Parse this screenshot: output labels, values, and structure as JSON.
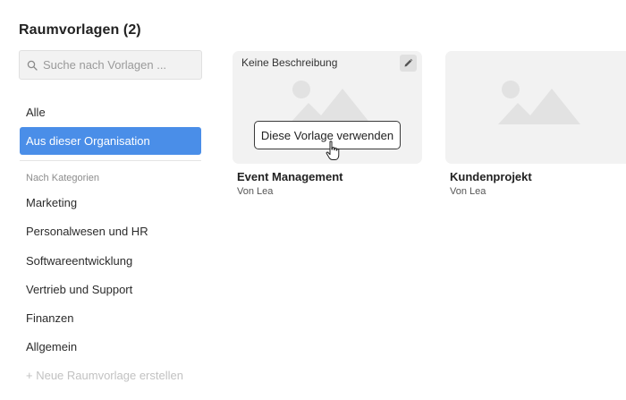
{
  "header": {
    "title": "Raumvorlagen (2)"
  },
  "search": {
    "placeholder": "Suche nach Vorlagen ..."
  },
  "sidebar": {
    "items": [
      {
        "label": "Alle",
        "active": false
      },
      {
        "label": "Aus dieser Organisation",
        "active": true
      }
    ],
    "section_label": "Nach Kategorien",
    "categories": [
      {
        "label": "Marketing"
      },
      {
        "label": "Personalwesen und HR"
      },
      {
        "label": "Softwareentwicklung"
      },
      {
        "label": "Vertrieb und Support"
      },
      {
        "label": "Finanzen"
      },
      {
        "label": "Allgemein"
      }
    ],
    "create_label": "+ Neue Raumvorlage erstellen"
  },
  "templates": [
    {
      "description": "Keine Beschreibung",
      "use_label": "Diese Vorlage verwenden",
      "name": "Event Management",
      "author": "Von Lea"
    },
    {
      "name": "Kundenprojekt",
      "author": "Von Lea"
    }
  ],
  "colors": {
    "accent": "#4a8ee8",
    "card_bg": "#f2f2f2",
    "placeholder_icon": "#e2e2e2"
  },
  "icons": {
    "search": "search-icon",
    "edit": "pencil-icon",
    "image": "image-placeholder-icon",
    "cursor": "hand-pointer-icon"
  }
}
